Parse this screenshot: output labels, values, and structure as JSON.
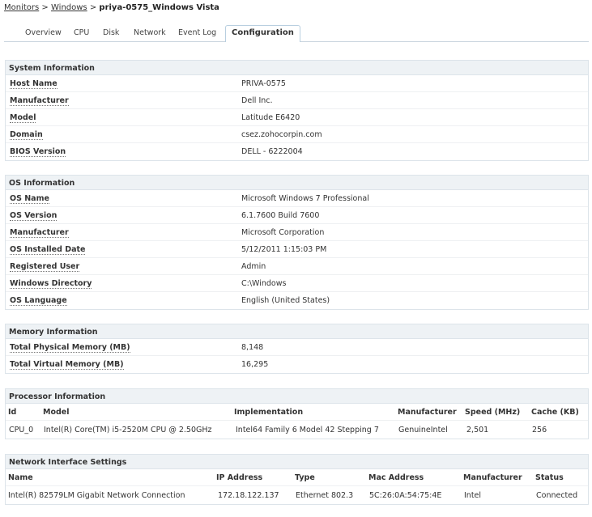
{
  "breadcrumb": {
    "monitors": "Monitors",
    "sep1": ">",
    "windows": "Windows",
    "sep2": ">",
    "current": "priya-0575_Windows Vista"
  },
  "tabs": [
    {
      "label": "Overview"
    },
    {
      "label": "CPU"
    },
    {
      "label": "Disk"
    },
    {
      "label": "Network"
    },
    {
      "label": "Event Log"
    },
    {
      "label": "Configuration",
      "active": true
    }
  ],
  "system": {
    "title": "System Information",
    "rows": [
      {
        "label": "Host Name",
        "value": "PRIVA-0575"
      },
      {
        "label": "Manufacturer",
        "value": "Dell Inc."
      },
      {
        "label": "Model",
        "value": "Latitude E6420"
      },
      {
        "label": "Domain",
        "value": "csez.zohocorpin.com"
      },
      {
        "label": "BIOS Version",
        "value": "DELL - 6222004"
      }
    ]
  },
  "os": {
    "title": "OS Information",
    "rows": [
      {
        "label": "OS Name",
        "value": "Microsoft Windows 7 Professional"
      },
      {
        "label": "OS Version",
        "value": "6.1.7600 Build 7600"
      },
      {
        "label": "Manufacturer",
        "value": "Microsoft Corporation"
      },
      {
        "label": "OS Installed Date",
        "value": "5/12/2011 1:15:03 PM"
      },
      {
        "label": "Registered User",
        "value": "Admin"
      },
      {
        "label": "Windows Directory",
        "value": "C:\\Windows"
      },
      {
        "label": "OS Language",
        "value": "English (United States)"
      }
    ]
  },
  "memory": {
    "title": "Memory Information",
    "rows": [
      {
        "label": "Total Physical Memory (MB)",
        "value": "8,148"
      },
      {
        "label": "Total Virtual Memory (MB)",
        "value": "16,295"
      }
    ]
  },
  "processor": {
    "title": "Processor Information",
    "headers": [
      "Id",
      "Model",
      "Implementation",
      "Manufacturer",
      "Speed (MHz)",
      "Cache (KB)"
    ],
    "row": [
      "CPU_0",
      "Intel(R) Core(TM) i5-2520M CPU @ 2.50GHz",
      "Intel64 Family 6 Model 42 Stepping 7",
      "GenuineIntel",
      "2,501",
      "256"
    ]
  },
  "network": {
    "title": "Network Interface Settings",
    "headers": [
      "Name",
      "IP Address",
      "Type",
      "Mac Address",
      "Manufacturer",
      "Status"
    ],
    "row": [
      "Intel(R) 82579LM Gigabit Network Connection",
      "172.18.122.137",
      "Ethernet 802.3",
      "5C:26:0A:54:75:4E",
      "Intel",
      "Connected"
    ]
  }
}
